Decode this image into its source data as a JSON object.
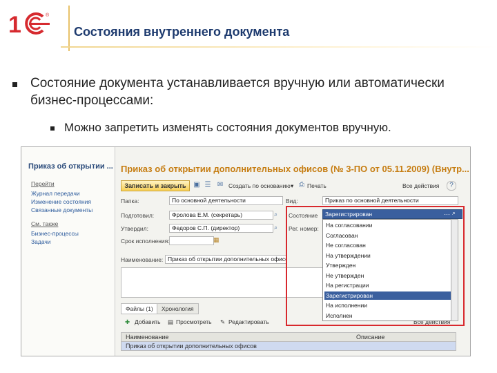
{
  "header": {
    "logo": "1С",
    "title": "Состояния внутреннего документа"
  },
  "bullets": [
    "Состояние документа устанавливается вручную или автоматически бизнес-процессами:",
    "Можно запретить изменять состояния документов вручную."
  ],
  "screenshot": {
    "left_panel": {
      "title": "Приказ об открытии ...",
      "sections": [
        {
          "heading": "Перейти",
          "items": [
            "Журнал передачи",
            "Изменение состояния",
            "Связанные документы"
          ]
        },
        {
          "heading": "См. также",
          "items": [
            "Бизнес-процессы",
            "Задачи"
          ]
        }
      ]
    },
    "window_title": "Приказ об открытии дополнительных офисов (№ 3-ПО от 05.11.2009) (Внутр...",
    "toolbar": {
      "save_close": "Записать и закрыть",
      "create_based": "Создать по основанию",
      "print": "Печать",
      "all_actions": "Все действия",
      "help": "?"
    },
    "form": {
      "folder_label": "Папка:",
      "folder_value": "По основной деятельности",
      "prepared_label": "Подготовил:",
      "prepared_value": "Фролова Е.М. (секретарь)",
      "approved_label": "Утвердил:",
      "approved_value": "Федоров С.П. (директор)",
      "deadline_label": "Срок исполнения:",
      "name_label": "Наименование:",
      "name_value": "Приказ об открытии дополнительных офисов",
      "kind_label": "Вид:",
      "kind_value": "Приказ по основной деятельности",
      "state_label": "Состояние",
      "state_value": "Зарегистрирован",
      "regnum_label": "Рег. номер:"
    },
    "state_options": [
      "На согласовании",
      "Согласован",
      "Не согласован",
      "На утверждении",
      "Утвержден",
      "Не утвержден",
      "На регистрации",
      "Зарегистрирован",
      "На исполнении",
      "Исполнен"
    ],
    "selected_option": "Зарегистрирован",
    "tabs": [
      "Файлы (1)",
      "Хронология"
    ],
    "sub_toolbar": {
      "add": "Добавить",
      "view": "Просмотреть",
      "edit": "Редактировать",
      "all_actions": "Все действия"
    },
    "grid": {
      "headers": [
        "Наименование",
        "Описание"
      ],
      "row": "Приказ об открытии дополнительных офисов"
    }
  }
}
